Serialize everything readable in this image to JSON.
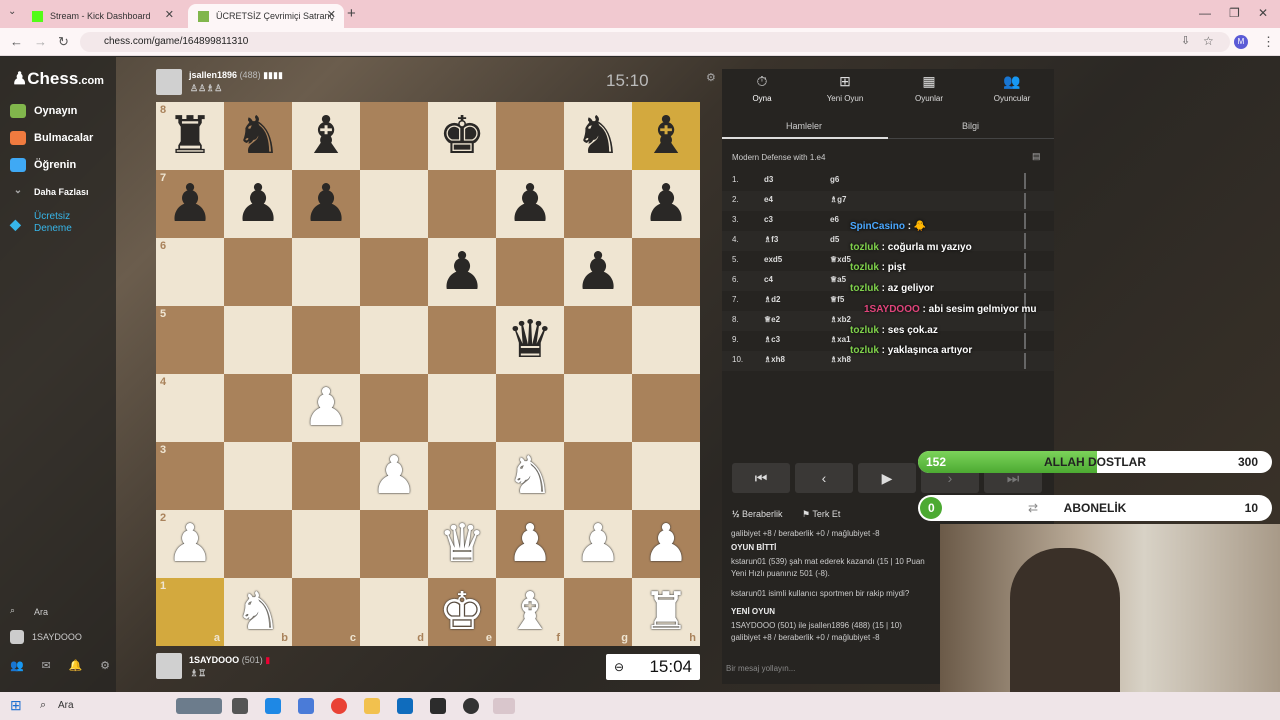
{
  "browser": {
    "tabs": [
      {
        "title": "Stream - Kick Dashboard",
        "favicon_color": "#53fc18"
      },
      {
        "title": "ÜCRETSİZ Çevrimiçi Satranç Oy...",
        "favicon_color": "#81b64c"
      }
    ],
    "url": "chess.com/game/164899811310"
  },
  "sidebar": {
    "logo_main": "Chess",
    "logo_suffix": ".com",
    "items": [
      {
        "label": "Oynayın",
        "icon": "play-icon",
        "color": "#81b64c"
      },
      {
        "label": "Bulmacalar",
        "icon": "puzzle-icon",
        "color": "#f07b3f"
      },
      {
        "label": "Öğrenin",
        "icon": "learn-icon",
        "color": "#3fa9f5"
      },
      {
        "label": "Daha Fazlası",
        "icon": "chevron-down-icon",
        "color": "#aaaaaa"
      },
      {
        "label": "Ücretsiz Deneme",
        "icon": "diamond-icon",
        "color": "#37b6e9"
      }
    ],
    "search": "Ara",
    "user": "1SAYDOOO"
  },
  "game": {
    "top_player": {
      "name": "jsallen1896",
      "rating": "(488)",
      "clock": "15:10"
    },
    "bottom_player": {
      "name": "1SAYDOOO",
      "rating": "(501)",
      "clock": "15:04"
    },
    "files": [
      "a",
      "b",
      "c",
      "d",
      "e",
      "f",
      "g",
      "h"
    ],
    "ranks": [
      "8",
      "7",
      "6",
      "5",
      "4",
      "3",
      "2",
      "1"
    ],
    "board": [
      [
        "br",
        "bn",
        "bb",
        "",
        "bk",
        "",
        "bn",
        "bb"
      ],
      [
        "bp",
        "bp",
        "bp",
        "",
        "",
        "bp",
        "",
        "bp"
      ],
      [
        "",
        "",
        "",
        "",
        "bp",
        "",
        "bp",
        ""
      ],
      [
        "",
        "",
        "",
        "",
        "",
        "bq",
        "",
        ""
      ],
      [
        "",
        "",
        "wp",
        "",
        "",
        "",
        "",
        ""
      ],
      [
        "",
        "",
        "",
        "wp",
        "",
        "wn",
        "",
        ""
      ],
      [
        "wp",
        "",
        "",
        "",
        "wq",
        "wp",
        "wp",
        "wp"
      ],
      [
        "",
        "wn",
        "",
        "",
        "wk",
        "wb",
        "",
        "wr"
      ]
    ],
    "highlight": [
      "h8",
      "a1"
    ]
  },
  "panel": {
    "tabs": [
      "Oyna",
      "Yeni Oyun",
      "Oyunlar",
      "Oyuncular"
    ],
    "subtabs": [
      "Hamleler",
      "Bilgi"
    ],
    "opening": "Modern Defense with 1.e4",
    "moves": [
      {
        "n": "1.",
        "w": "d3",
        "b": "g6"
      },
      {
        "n": "2.",
        "w": "e4",
        "b": "♗g7"
      },
      {
        "n": "3.",
        "w": "c3",
        "b": "e6"
      },
      {
        "n": "4.",
        "w": "♗f3",
        "b": "d5"
      },
      {
        "n": "5.",
        "w": "exd5",
        "b": "♕xd5"
      },
      {
        "n": "6.",
        "w": "c4",
        "b": "♕a5"
      },
      {
        "n": "7.",
        "w": "♗d2",
        "b": "♕f5"
      },
      {
        "n": "8.",
        "w": "♕e2",
        "b": "♗xb2"
      },
      {
        "n": "9.",
        "w": "♗c3",
        "b": "♗xa1"
      },
      {
        "n": "10.",
        "w": "♗xh8",
        "b": "♗xh8"
      }
    ],
    "draw": "Beraberlik",
    "resign": "Terk Et",
    "chat": [
      "galibiyet +8 / beraberlik +0 / mağlubiyet -8",
      "OYUN BİTTİ",
      "kstarun01 (539) şah mat ederek kazandı (15 | 10 Puan",
      "Yeni Hızlı puanınız 501 (-8).",
      "kstarun01 isimli kullanıcı sportmen bir rakip miydi?",
      "YENİ OYUN",
      "1SAYDOOO (501) ile jsallen1896 (488) (15 | 10)",
      "galibiyet +8 / beraberlik +0 / mağlubiyet -8"
    ],
    "message_placeholder": "Bir mesaj yollayın..."
  },
  "overlay": {
    "chat": [
      {
        "user": "SpinCasino",
        "msg": "",
        "emote": true
      },
      {
        "user": "tozluk",
        "msg": "coğurla mı yazıyo"
      },
      {
        "user": "tozluk",
        "msg": "pişt"
      },
      {
        "user": "tozluk",
        "msg": "az geliyor"
      },
      {
        "user": "1SAYDOOO",
        "msg": "abi sesim gelmiyor mu"
      },
      {
        "user": "tozluk",
        "msg": "ses çok.az"
      },
      {
        "user": "tozluk",
        "msg": "yaklaşınca artıyor"
      }
    ],
    "goal1": {
      "current": "152",
      "label": "ALLAH DOSTLAR",
      "target": "300",
      "progress": 0.507
    },
    "goal2": {
      "current": "0",
      "label": "ABONELİK",
      "target": "10",
      "progress": 0
    }
  },
  "taskbar": {
    "search": "Ara"
  }
}
